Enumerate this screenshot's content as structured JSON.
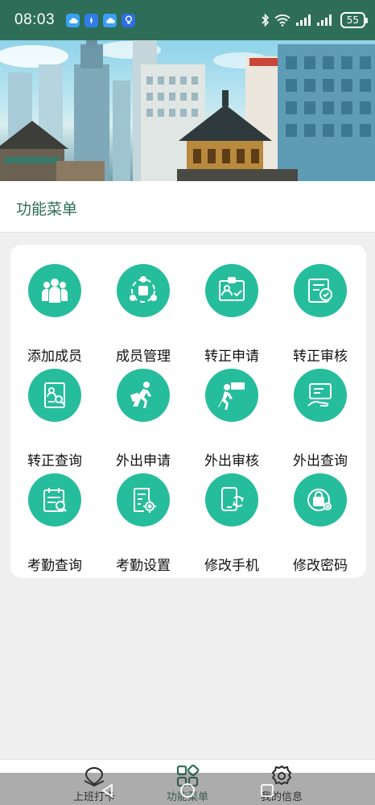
{
  "status_bar": {
    "time": "08:03",
    "battery": "55",
    "app_icons": [
      "cloud-app-icon",
      "compass-app-icon",
      "cloud-app-icon",
      "bulb-app-icon"
    ],
    "indicators": [
      "bluetooth-icon",
      "wifi-icon",
      "signal-icon",
      "signal-icon",
      "battery-icon"
    ]
  },
  "banner": {
    "alt_description_icon": "city-buildings-banner-image"
  },
  "page": {
    "title": "功能菜单"
  },
  "menu": {
    "items": [
      {
        "label": "添加成员",
        "icon": "add-members-icon"
      },
      {
        "label": "成员管理",
        "icon": "member-management-icon"
      },
      {
        "label": "转正申请",
        "icon": "regularization-apply-icon"
      },
      {
        "label": "转正审核",
        "icon": "regularization-review-icon"
      },
      {
        "label": "转正查询",
        "icon": "regularization-query-icon"
      },
      {
        "label": "外出申请",
        "icon": "outing-apply-icon"
      },
      {
        "label": "外出审核",
        "icon": "outing-review-icon"
      },
      {
        "label": "外出查询",
        "icon": "outing-query-icon"
      },
      {
        "label": "考勤查询",
        "icon": "attendance-query-icon"
      },
      {
        "label": "考勤设置",
        "icon": "attendance-settings-icon"
      },
      {
        "label": "修改手机",
        "icon": "change-phone-icon"
      },
      {
        "label": "修改密码",
        "icon": "change-password-icon"
      }
    ]
  },
  "bottom_nav": {
    "items": [
      {
        "label": "上班打卡",
        "icon": "clock-in-icon"
      },
      {
        "label": "功能菜单",
        "icon": "function-menu-icon",
        "active": true
      },
      {
        "label": "我的信息",
        "icon": "gear-icon"
      }
    ]
  },
  "colors": {
    "brand_green": "#2e6e58",
    "icon_teal": "#26bd9c",
    "background": "#efefef"
  }
}
